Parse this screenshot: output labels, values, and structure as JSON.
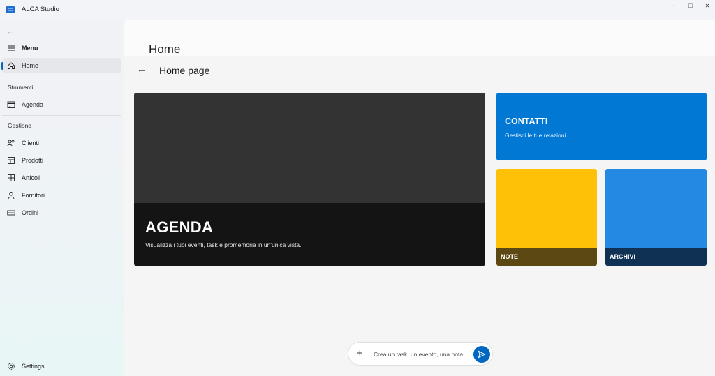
{
  "window": {
    "title": "ALCA Studio",
    "controls": {
      "minimize": "–",
      "maximize": "□",
      "close": "✕"
    }
  },
  "debug_toolbar": {
    "icons": [
      "live-tree-icon",
      "video-icon",
      "select-element-icon",
      "layout-adorner-icon",
      "track-focus-icon",
      "binding-failures-icon",
      "accessibility-icon",
      "hot-reload-icon",
      "collapse-chevron-icon"
    ],
    "accent": "#e81123"
  },
  "sidebar": {
    "menu_label": "Menu",
    "home_label": "Home",
    "section_strumenti": "Strumenti",
    "agenda_label": "Agenda",
    "section_gestione": "Gestione",
    "clienti_label": "Clienti",
    "prodotti_label": "Prodotti",
    "articoli_label": "Articoli",
    "fornitori_label": "Fornitori",
    "ordini_label": "Ordini",
    "settings_label": "Settings"
  },
  "main": {
    "page_title": "Home",
    "sub_title": "Home page",
    "tiles": {
      "agenda": {
        "title": "AGENDA",
        "description": "Visualizza i tuoi eventi, task e promemoria in un'unica vista.",
        "color": "#333333"
      },
      "contatti": {
        "title": "CONTATTI",
        "description": "Gestisci le tue relazioni",
        "color": "#0078d4"
      },
      "note": {
        "title": "NOTE",
        "color": "#ffc107"
      },
      "archivi": {
        "title": "ARCHIVI",
        "color": "#2389e3"
      }
    },
    "quick_input": {
      "placeholder": "Crea un task, un evento, una nota..."
    }
  },
  "colors": {
    "accent": "#0067c0"
  }
}
